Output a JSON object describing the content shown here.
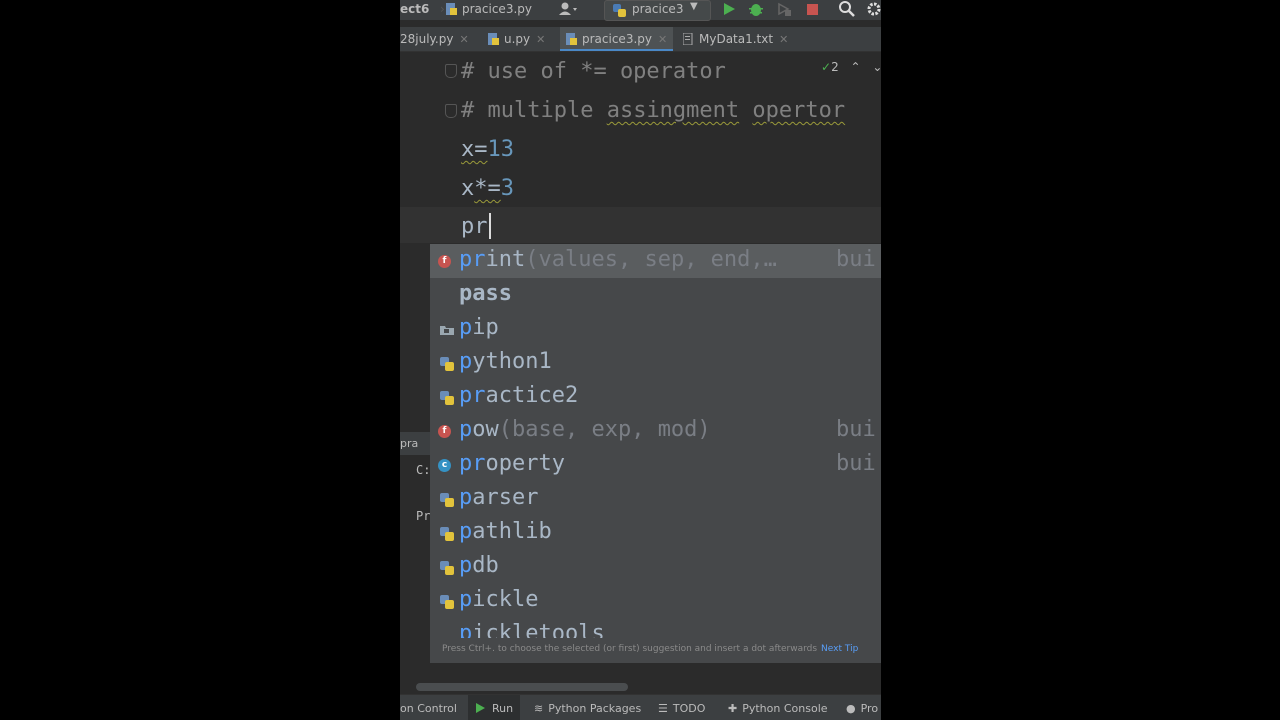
{
  "toolbar": {
    "project_name": "ect6",
    "current_file": "pracice3.py",
    "run_config": "pracice3"
  },
  "tabs": [
    {
      "label": "28july.py"
    },
    {
      "label": "u.py"
    },
    {
      "label": "pracice3.py"
    },
    {
      "label": "MyData1.txt"
    }
  ],
  "inspection": {
    "count": "2"
  },
  "code_lines": {
    "line1": "# use of *= operator",
    "line2_prefix": "# multiple ",
    "line2_w1": "assingment",
    "line2_w2": "opertor",
    "line3_var": "x=",
    "line3_num": "13",
    "line4_var": "x",
    "line4_op": "*=",
    "line4_num": "3",
    "line5": "pr"
  },
  "completion": {
    "items": [
      {
        "match": "pr",
        "rest": "int",
        "sig": "(values, sep, end,…",
        "tail": "bui",
        "kind": "f"
      },
      {
        "match": "",
        "rest": "pass",
        "sig": "",
        "tail": "",
        "kind": "keyword"
      },
      {
        "match": "p",
        "rest": "ip",
        "sig": "",
        "tail": "",
        "kind": "package"
      },
      {
        "match": "p",
        "rest": "ython1",
        "sig": "",
        "tail": "",
        "kind": "module"
      },
      {
        "match": "pr",
        "rest": "actice2",
        "sig": "",
        "tail": "",
        "kind": "module"
      },
      {
        "match": "p",
        "rest": "ow",
        "sig": "(base, exp, mod)",
        "tail": "bui",
        "kind": "f"
      },
      {
        "match": "pr",
        "rest": "operty",
        "sig": "",
        "tail": "bui",
        "kind": "c"
      },
      {
        "match": "p",
        "rest": "arser",
        "sig": "",
        "tail": "",
        "kind": "module"
      },
      {
        "match": "p",
        "rest": "athlib",
        "sig": "",
        "tail": "",
        "kind": "module"
      },
      {
        "match": "p",
        "rest": "db",
        "sig": "",
        "tail": "",
        "kind": "module"
      },
      {
        "match": "p",
        "rest": "ickle",
        "sig": "",
        "tail": "",
        "kind": "module"
      },
      {
        "match": "p",
        "rest": "ickletools",
        "sig": "",
        "tail": "",
        "kind": "module"
      }
    ],
    "hint_text": "Press Ctrl+. to choose the selected (or first) suggestion and insert a dot afterwards",
    "hint_link": "Next Tip"
  },
  "run_panel": {
    "tab_label": "pra",
    "line1": "C:",
    "line2": "Pr"
  },
  "bottom_bar": {
    "version_control": "on Control",
    "run": "Run",
    "packages": "Python Packages",
    "todo": "TODO",
    "console": "Python Console",
    "problems": "Pro"
  },
  "colors": {
    "editor_bg": "#2b2b2b",
    "popup_bg": "#46484a",
    "match_blue": "#589df6",
    "number": "#6897bb",
    "comment": "#808080",
    "run_green": "#4caf50",
    "stop_red": "#c75450"
  }
}
